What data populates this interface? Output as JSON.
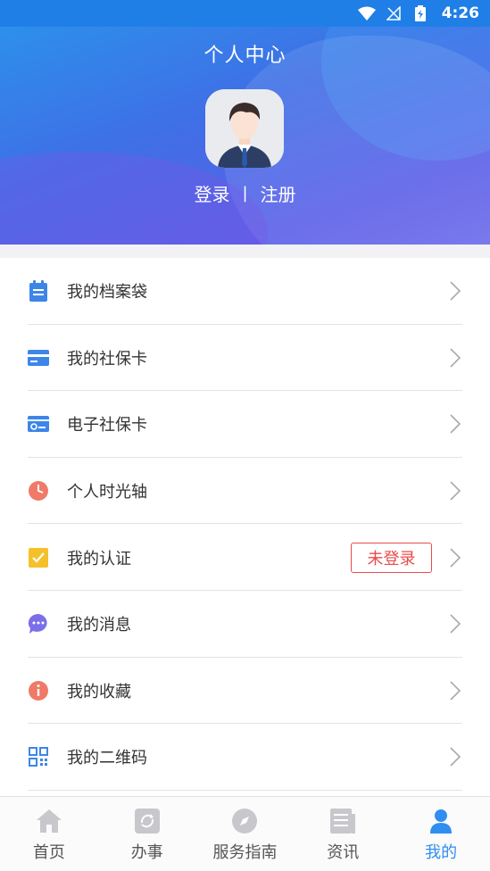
{
  "status_bar": {
    "time": "4:26"
  },
  "header": {
    "title": "个人中心",
    "login_label": "登录",
    "separator": "|",
    "register_label": "注册"
  },
  "menu": {
    "items": [
      {
        "label": "我的档案袋",
        "icon": "clipboard-icon",
        "color": "#3d86e8"
      },
      {
        "label": "我的社保卡",
        "icon": "card-icon",
        "color": "#3d86e8"
      },
      {
        "label": "电子社保卡",
        "icon": "ecard-icon",
        "color": "#3d86e8"
      },
      {
        "label": "个人时光轴",
        "icon": "clock-icon",
        "color": "#f07a68"
      },
      {
        "label": "我的认证",
        "icon": "checkbox-icon",
        "color": "#f5c12a",
        "badge": "未登录"
      },
      {
        "label": "我的消息",
        "icon": "chat-icon",
        "color": "#7a6fe8"
      },
      {
        "label": "我的收藏",
        "icon": "info-icon",
        "color": "#f07a68"
      },
      {
        "label": "我的二维码",
        "icon": "qrcode-icon",
        "color": "#3d86e8"
      }
    ]
  },
  "tabbar": {
    "tabs": [
      {
        "label": "首页",
        "icon": "home-icon"
      },
      {
        "label": "办事",
        "icon": "refresh-icon"
      },
      {
        "label": "服务指南",
        "icon": "compass-icon"
      },
      {
        "label": "资讯",
        "icon": "news-icon"
      },
      {
        "label": "我的",
        "icon": "user-icon",
        "active": true
      }
    ],
    "active_color": "#2f8ef0",
    "inactive_color": "#c8c8cc"
  }
}
